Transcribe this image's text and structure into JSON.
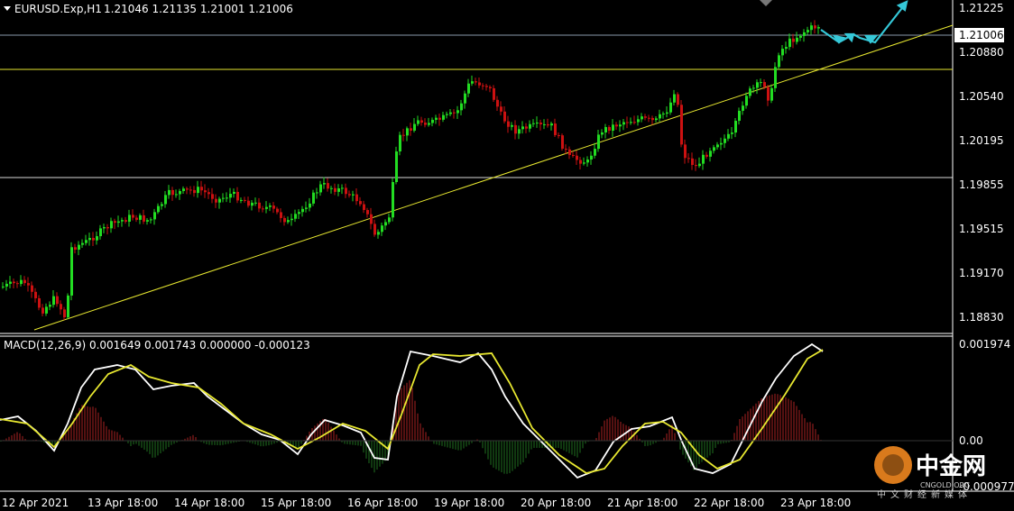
{
  "header": {
    "symbol": "EURUSD.Exp,H1",
    "ohlc": "1.21046 1.21135 1.21001 1.21006"
  },
  "macd_header": {
    "label": "MACD(12,26,9) 0.001649 0.001743 0.000000 -0.000123"
  },
  "price_axis": {
    "ticks": [
      "1.21225",
      "1.20880",
      "1.20540",
      "1.20195",
      "1.19855",
      "1.19515",
      "1.19170",
      "1.18830"
    ],
    "current_price": "1.21006"
  },
  "macd_axis": {
    "ticks": [
      "0.001974",
      "0.00",
      "-0.000977"
    ]
  },
  "time_axis": {
    "labels": [
      "12 Apr 2021",
      "13 Apr 18:00",
      "14 Apr 18:00",
      "15 Apr 18:00",
      "16 Apr 18:00",
      "19 Apr 18:00",
      "20 Apr 18:00",
      "21 Apr 18:00",
      "22 Apr 18:00",
      "23 Apr 18:00"
    ]
  },
  "watermark": {
    "brand": "中金网",
    "domain": "CNGOLD.ORG",
    "slogan": "中文财经新媒体"
  },
  "colors": {
    "background": "#000000",
    "bull": "#22dd22",
    "bear": "#cc1111",
    "trendline": "#e8e830",
    "grid_text": "#ffffff",
    "arrow": "#35c8d8",
    "macd_line": "#ffffff",
    "signal_line": "#e8e830",
    "hist_pos": "#aa2222",
    "hist_neg": "#1f6f1f",
    "price_line": "#8899aa"
  }
}
